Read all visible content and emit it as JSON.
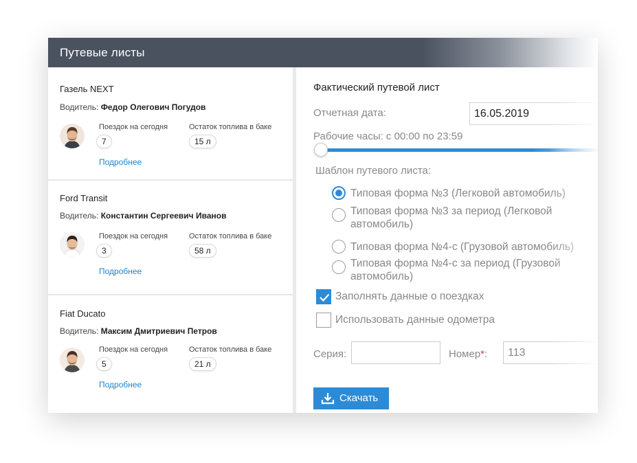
{
  "window": {
    "title": "Путевые листы"
  },
  "trips": [
    {
      "vehicle": "Газель NEXT",
      "driver_prefix": "Водитель:",
      "driver_name": "Федор Олегович Погудов",
      "trips_label": "Поездок на сегодня",
      "trips_count": "7",
      "fuel_label": "Остаток топлива в баке",
      "fuel_value": "15 л",
      "more_link": "Подробнее"
    },
    {
      "vehicle": "Ford Transit",
      "driver_prefix": "Водитель:",
      "driver_name": "Константин Сергеевич Иванов",
      "trips_label": "Поездок на сегодня",
      "trips_count": "3",
      "fuel_label": "Остаток топлива в баке",
      "fuel_value": "58 л",
      "more_link": "Подробнее"
    },
    {
      "vehicle": "Fiat Ducato",
      "driver_prefix": "Водитель:",
      "driver_name": "Максим Дмитриевич Петров",
      "trips_label": "Поездок на сегодня",
      "trips_count": "5",
      "fuel_label": "Остаток топлива в баке",
      "fuel_value": "21 л",
      "more_link": "Подробнее"
    }
  ],
  "form": {
    "title": "Фактический путевой лист",
    "report_date_label": "Отчетная дата:",
    "report_date_value": "16.05.2019",
    "hours_label": "Рабочие часы: с 00:00 по 23:59",
    "hours_start_fraction": 0,
    "template_label": "Шаблон путевого листа:",
    "templates": [
      {
        "label": "Типовая форма №3 (Легковой автомобиль)",
        "selected": true
      },
      {
        "label": "Типовая форма №3 за период (Легковой автомобиль)",
        "selected": false
      },
      {
        "label": "Типовая форма №4-с (Грузовой автомобиль)",
        "selected": false
      },
      {
        "label": "Типовая форма №4-с за период (Грузовой автомобиль)",
        "selected": false
      }
    ],
    "fill_trips_label": "Заполнять данные о поездках",
    "fill_trips_checked": true,
    "use_odometer_label": "Использовать данные одометра",
    "use_odometer_checked": false,
    "series_label": "Серия:",
    "series_value": "",
    "number_label": "Номер",
    "required_mark": "*",
    "number_suffix": ":",
    "number_value": "113",
    "download_label": "Скачать"
  },
  "colors": {
    "accent": "#2d8bd6",
    "link": "#1a85cf",
    "titlebar": "#4a5260",
    "required": "#e03b3b"
  }
}
